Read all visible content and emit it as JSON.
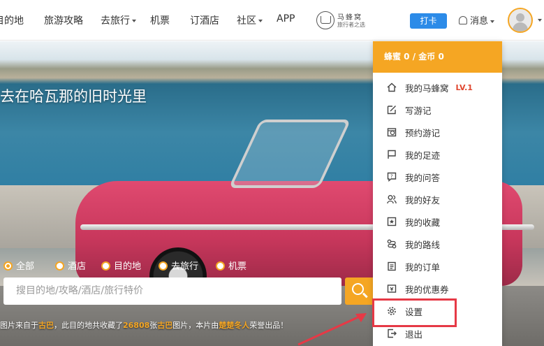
{
  "nav": {
    "items": [
      "目的地",
      "旅游攻略",
      "去旅行",
      "机票",
      "订酒店",
      "社区",
      "APP"
    ],
    "brand_name": "马蜂窝",
    "brand_slogan": "旅行者之选",
    "checkin_label": "打卡",
    "messages_label": "消息"
  },
  "hero": {
    "title": "去在哈瓦那的旧时光里",
    "radios": [
      "全部",
      "酒店",
      "目的地",
      "去旅行",
      "机票"
    ],
    "selected_radio": "全部",
    "search_placeholder": "搜目的地/攻略/酒店/旅行特价",
    "credit": {
      "prefix": "图片来自于",
      "place": "古巴",
      "mid": "，此目的地共收藏了",
      "count": "26808",
      "mid2": "张",
      "place2": "古巴",
      "mid3": "图片，本片由",
      "author": "楚楚冬人",
      "suffix": "荣誉出品！"
    }
  },
  "dropdown": {
    "header": "蜂蜜 0 / 金币 0",
    "level": "LV.1",
    "items": [
      {
        "label": "我的马蜂窝",
        "icon": "home-icon"
      },
      {
        "label": "写游记",
        "icon": "edit-icon"
      },
      {
        "label": "预约游记",
        "icon": "schedule-icon"
      },
      {
        "label": "我的足迹",
        "icon": "flag-icon"
      },
      {
        "label": "我的问答",
        "icon": "question-icon"
      },
      {
        "label": "我的好友",
        "icon": "friends-icon"
      },
      {
        "label": "我的收藏",
        "icon": "star-icon"
      },
      {
        "label": "我的路线",
        "icon": "route-icon"
      },
      {
        "label": "我的订单",
        "icon": "order-icon"
      },
      {
        "label": "我的优惠券",
        "icon": "coupon-icon"
      },
      {
        "label": "设置",
        "icon": "gear-icon"
      },
      {
        "label": "退出",
        "icon": "logout-icon"
      }
    ],
    "highlighted_item": "设置"
  },
  "colors": {
    "accent": "#f5a623",
    "checkin_blue": "#2c8be8",
    "highlight_red": "#e63946"
  }
}
